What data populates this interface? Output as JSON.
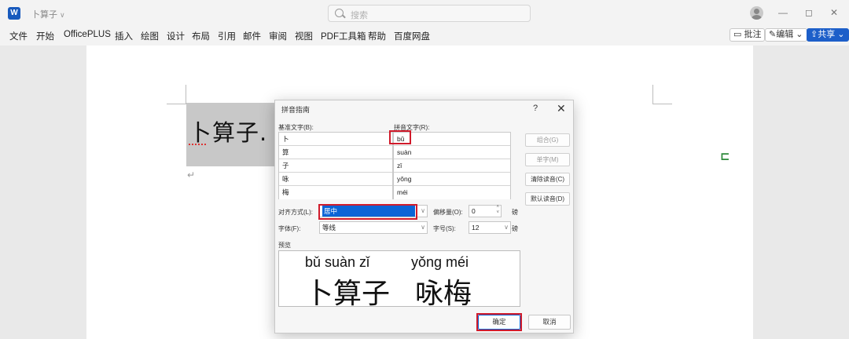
{
  "titlebar": {
    "app_icon": "word-icon",
    "doc_title": "卜算子",
    "search_placeholder": "搜索",
    "minimize": "—",
    "restore": "◻",
    "close": "✕"
  },
  "menu": [
    "文件",
    "开始",
    "OfficePLUS",
    "插入",
    "绘图",
    "设计",
    "布局",
    "引用",
    "邮件",
    "审阅",
    "视图",
    "PDF工具箱",
    "帮助",
    "百度网盘"
  ],
  "ribbon_right": {
    "comment": "批注",
    "edit": "编辑",
    "share": "共享"
  },
  "document": {
    "selected_text": "卜算子.",
    "paragraph_mark": "↵"
  },
  "dialog": {
    "title": "拼音指南",
    "help": "?",
    "close": "✕",
    "base_label": "基准文字(B):",
    "ruby_label": "拼音文字(R):",
    "rows": [
      {
        "base": "卜",
        "ruby": "bǔ"
      },
      {
        "base": "算",
        "ruby": "suàn"
      },
      {
        "base": "子",
        "ruby": "zǐ"
      },
      {
        "base": "咏",
        "ruby": "yǒng"
      },
      {
        "base": "梅",
        "ruby": "méi"
      }
    ],
    "side_buttons": {
      "group": "组合(G)",
      "mono": "单字(M)",
      "clear": "清除读音(C)",
      "default": "默认读音(D)"
    },
    "alignment_label": "对齐方式(L):",
    "alignment_value": "居中",
    "offset_label": "偏移量(O):",
    "offset_value": "0",
    "offset_unit": "磅",
    "font_label": "字体(F):",
    "font_value": "等线",
    "size_label": "字号(S):",
    "size_value": "12",
    "size_unit": "磅",
    "preview_label": "预览",
    "preview": {
      "pinyin_1": "bǔ suàn zǐ",
      "pinyin_2": "yǒng méi",
      "chars_1": "卜算子",
      "chars_2": "咏梅"
    },
    "ok": "确定",
    "cancel": "取消"
  },
  "colors": {
    "accent": "#1d5fc9",
    "selection": "#0a64d6",
    "annotation": "#d01b2b"
  }
}
